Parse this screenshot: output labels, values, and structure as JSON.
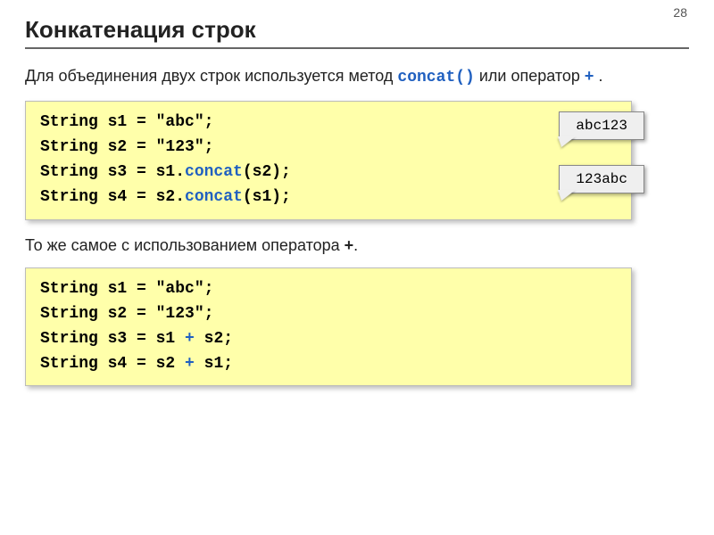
{
  "page_number": "28",
  "title": "Конкатенация строк",
  "intro": {
    "prefix": "Для объединения двух строк используется метод ",
    "method": "concat()",
    "mid": " или оператор ",
    "op": "+",
    "suffix": "."
  },
  "code1": {
    "line1a": "String s1 = \"abc\";",
    "line2a": "String s2 = \"123\";",
    "line3_pre": "String s3 = s1.",
    "line3_method": "concat",
    "line3_post": "(s2);",
    "line4_pre": "String s4 = s2.",
    "line4_method": "concat",
    "line4_post": "(s1);"
  },
  "outputs": {
    "o1": "abc123",
    "o2": "123abc"
  },
  "subtext": {
    "pre": "То же самое с использованием оператора ",
    "op": "+",
    "post": "."
  },
  "code2": {
    "line1": "String s1 = \"abc\";",
    "line2": "String s2 = \"123\";",
    "line3_pre": "String s3 = s1 ",
    "line3_op": "+",
    "line3_post": " s2;",
    "line4_pre": "String s4 = s2 ",
    "line4_op": "+",
    "line4_post": " s1;"
  }
}
